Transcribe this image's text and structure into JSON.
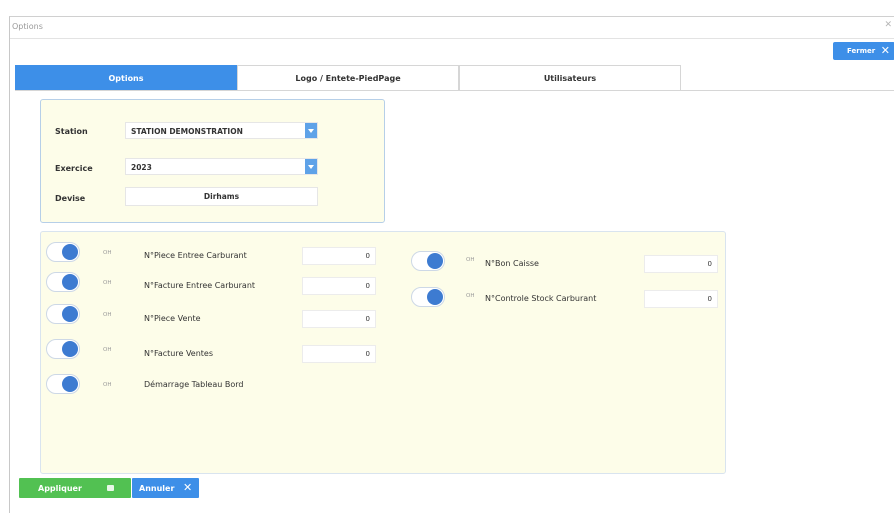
{
  "window": {
    "title": "Options",
    "close_icon": "close-icon"
  },
  "header": {
    "close_button": {
      "label": "Fermer",
      "icon": "close-icon"
    }
  },
  "tabs": [
    {
      "label": "Options",
      "active": true
    },
    {
      "label": "Logo / Entete-PiedPage",
      "active": false
    },
    {
      "label": "Utilisateurs",
      "active": false
    }
  ],
  "settings": {
    "station": {
      "label": "Station",
      "value": "STATION DEMONSTRATION"
    },
    "exercice": {
      "label": "Exercice",
      "value": "2023"
    },
    "devise": {
      "label": "Devise",
      "value": "Dirhams"
    }
  },
  "toggles_left": [
    {
      "state_label": "OH",
      "label": "N°Piece Entree Carburant",
      "value": "0"
    },
    {
      "state_label": "OH",
      "label": "N°Facture  Entree Carburant",
      "value": "0"
    },
    {
      "state_label": "OH",
      "label": "N°Piece Vente",
      "value": "0"
    },
    {
      "state_label": "OH",
      "label": "N°Facture Ventes",
      "value": "0"
    },
    {
      "state_label": "OH",
      "label": "Démarrage Tableau Bord"
    }
  ],
  "toggles_right": [
    {
      "state_label": "OH",
      "label": "N°Bon Caisse",
      "value": "0"
    },
    {
      "state_label": "OH",
      "label": "N°Controle Stock Carburant",
      "value": "0"
    }
  ],
  "footer": {
    "apply_label": "Appliquer",
    "cancel_label": "Annuler"
  },
  "colors": {
    "accent": "#3d8fe8",
    "panel_bg": "#fdfde9",
    "apply_green": "#52c152",
    "toggle_knob": "#3d7bd1"
  }
}
